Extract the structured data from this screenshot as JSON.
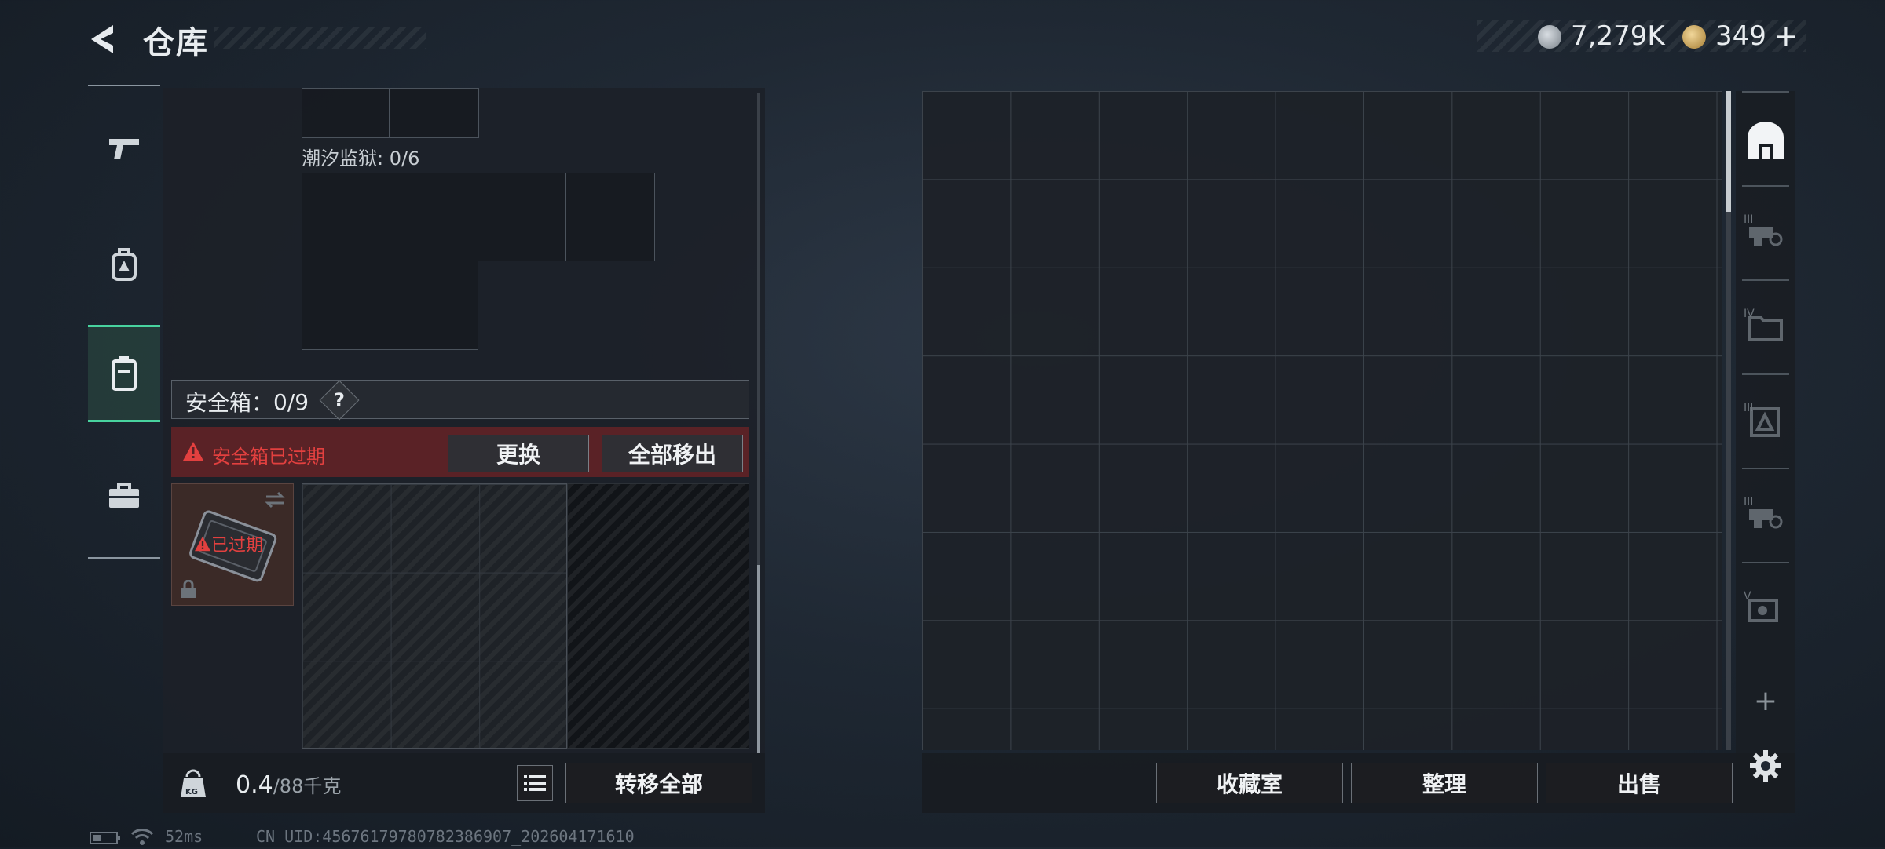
{
  "header": {
    "title": "仓库",
    "currencies": [
      {
        "icon": "silver-coin-icon",
        "value": "7,279K"
      },
      {
        "icon": "gold-coin-icon",
        "value": "349"
      }
    ],
    "add_label": "+"
  },
  "left_nav": [
    {
      "icon": "pistol-icon",
      "active": false
    },
    {
      "icon": "backpack-icon",
      "active": false
    },
    {
      "icon": "vest-icon",
      "active": true
    },
    {
      "icon": "toolbox-icon",
      "active": false
    }
  ],
  "left_panel": {
    "container_label": "潮汐监狱: 0/6",
    "safe_box": {
      "label": "安全箱",
      "colon": "：",
      "count": "0/9",
      "help": "?",
      "expired_text": "安全箱已过期",
      "replace_button": "更换",
      "move_all_button": "全部移出",
      "card_expired_label": "已过期"
    },
    "weight": {
      "current": "0.4",
      "max": "/88千克",
      "icon_text": "KG"
    },
    "transfer_all_button": "转移全部"
  },
  "right_tabs": [
    {
      "icon": "vault-icon",
      "roman": ""
    },
    {
      "icon": "weapon-parts-icon",
      "roman": "III"
    },
    {
      "icon": "folder-icon",
      "roman": "IV"
    },
    {
      "icon": "medical-icon",
      "roman": "III"
    },
    {
      "icon": "weapon-parts-icon",
      "roman": "III"
    },
    {
      "icon": "gear-parts-icon",
      "roman": "V"
    }
  ],
  "right_panel": {
    "add_tab": "+",
    "collection_button": "收藏室",
    "sort_button": "整理",
    "sell_button": "出售"
  },
  "status_bar": {
    "ping": "52ms",
    "uid": "CN UID:45676179780782386907_202604171610"
  },
  "colors": {
    "accent_green": "#48d39f",
    "alert_red": "#e2403f",
    "expired_bg": "#5a2226"
  }
}
